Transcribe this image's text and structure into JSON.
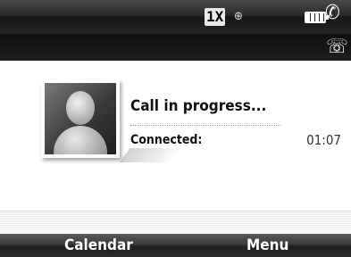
{
  "status_bar": {
    "network_label": "1X",
    "roaming_icon": "roaming-icon",
    "battery_icon": "battery-icon",
    "phone_icon": "phone-signal-icon"
  },
  "call_bar": {
    "icon": "active-call-icon"
  },
  "call": {
    "status_text": "Call in progress...",
    "connected_label": "Connected:",
    "duration": "01:07",
    "avatar_icon": "contact-avatar-icon"
  },
  "softkeys": {
    "left_label": "Calendar",
    "right_label": "Menu"
  }
}
